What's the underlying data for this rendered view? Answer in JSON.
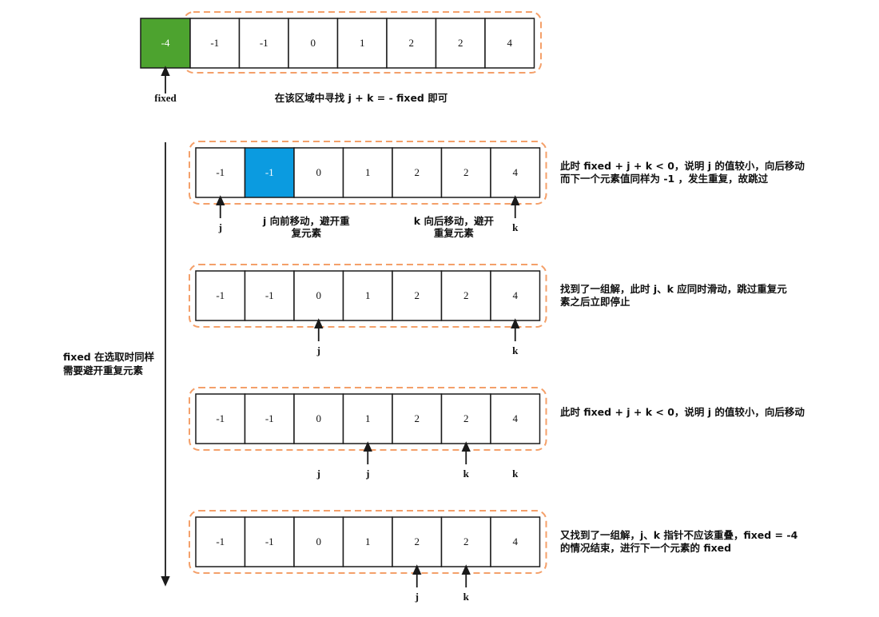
{
  "colors": {
    "frame": "#f4a06a",
    "cell_border": "#1a1a1a",
    "fixed_fill": "#4da32f",
    "highlight_fill": "#0b9be0",
    "arrow": "#1a1a1a"
  },
  "top": {
    "fixed_value": "-4",
    "values": [
      "-1",
      "-1",
      "0",
      "1",
      "2",
      "2",
      "4"
    ],
    "fixed_label": "fixed",
    "caption": "在该区域中寻找 j + k = - fixed 即可"
  },
  "side_note": [
    "fixed 在选取时同样",
    "需要避开重复元素"
  ],
  "rows": [
    {
      "values": [
        "-1",
        "-1",
        "0",
        "1",
        "2",
        "2",
        "4"
      ],
      "highlight": 1,
      "arrows": [
        0,
        6
      ],
      "labels": [
        {
          "text": "j",
          "col": 0
        },
        {
          "text": "k",
          "col": 6
        }
      ],
      "inline_notes": [
        {
          "lines": [
            "j 向前移动，避开重",
            "复元素"
          ],
          "col": 1.75
        },
        {
          "lines": [
            "k 向后移动，避开",
            "重复元素"
          ],
          "col": 4.75
        }
      ],
      "note": [
        "此时 fixed + j + k < 0，说明 j 的值较小，向后移动",
        "而下一个元素值同样为 -1 ，发生重复，故跳过"
      ]
    },
    {
      "values": [
        "-1",
        "-1",
        "0",
        "1",
        "2",
        "2",
        "4"
      ],
      "highlight": -1,
      "arrows": [
        2,
        6
      ],
      "labels": [
        {
          "text": "j",
          "col": 2
        },
        {
          "text": "k",
          "col": 6
        }
      ],
      "inline_notes": [],
      "note": [
        "找到了一组解，此时 j、k 应同时滑动，跳过重复元",
        "素之后立即停止"
      ]
    },
    {
      "values": [
        "-1",
        "-1",
        "0",
        "1",
        "2",
        "2",
        "4"
      ],
      "highlight": -1,
      "arrows": [
        3,
        5
      ],
      "labels": [
        {
          "text": "j",
          "col": 2
        },
        {
          "text": "j",
          "col": 3
        },
        {
          "text": "k",
          "col": 5
        },
        {
          "text": "k",
          "col": 6
        }
      ],
      "inline_notes": [],
      "note": [
        "此时 fixed + j + k < 0，说明 j 的值较小，向后移动"
      ]
    },
    {
      "values": [
        "-1",
        "-1",
        "0",
        "1",
        "2",
        "2",
        "4"
      ],
      "highlight": -1,
      "arrows": [
        4,
        5
      ],
      "labels": [
        {
          "text": "j",
          "col": 4
        },
        {
          "text": "k",
          "col": 5
        }
      ],
      "inline_notes": [],
      "note": [
        "又找到了一组解，j、k 指针不应该重叠，fixed = -4",
        "的情况结束，进行下一个元素的 fixed"
      ]
    }
  ]
}
